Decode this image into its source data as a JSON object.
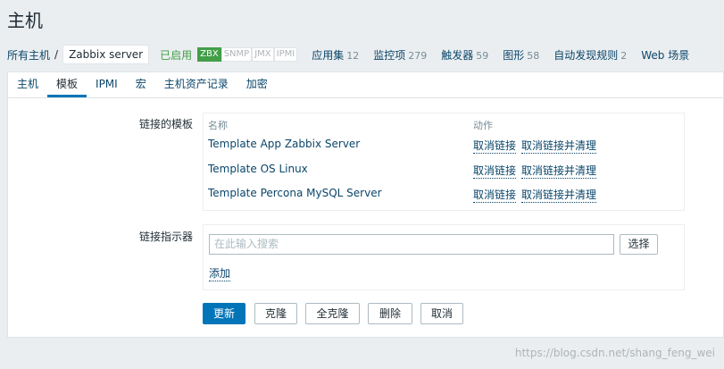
{
  "page": {
    "title": "主机"
  },
  "nav": {
    "all_hosts": "所有主机",
    "separator": "/",
    "current_host": "Zabbix server",
    "status": "已启用",
    "availability": [
      {
        "label": "ZBX",
        "active": true
      },
      {
        "label": "SNMP",
        "active": false
      },
      {
        "label": "JMX",
        "active": false
      },
      {
        "label": "IPMI",
        "active": false
      }
    ],
    "links": [
      {
        "label": "应用集",
        "count": "12"
      },
      {
        "label": "监控项",
        "count": "279"
      },
      {
        "label": "触发器",
        "count": "59"
      },
      {
        "label": "图形",
        "count": "58"
      },
      {
        "label": "自动发现规则",
        "count": "2"
      },
      {
        "label": "Web 场景",
        "count": ""
      }
    ]
  },
  "tabs": [
    {
      "label": "主机",
      "active": false
    },
    {
      "label": "模板",
      "active": true
    },
    {
      "label": "IPMI",
      "active": false
    },
    {
      "label": "宏",
      "active": false
    },
    {
      "label": "主机资产记录",
      "active": false
    },
    {
      "label": "加密",
      "active": false
    }
  ],
  "linked_templates": {
    "label": "链接的模板",
    "col_name": "名称",
    "col_action": "动作",
    "rows": [
      {
        "name": "Template App Zabbix Server",
        "unlink": "取消链接",
        "unlink_clear": "取消链接并清理"
      },
      {
        "name": "Template OS Linux",
        "unlink": "取消链接",
        "unlink_clear": "取消链接并清理"
      },
      {
        "name": "Template Percona MySQL Server",
        "unlink": "取消链接",
        "unlink_clear": "取消链接并清理"
      }
    ]
  },
  "link_new": {
    "label": "链接指示器",
    "search_placeholder": "在此输入搜索",
    "select_button": "选择",
    "add_link": "添加"
  },
  "actions": {
    "update": "更新",
    "clone": "克隆",
    "full_clone": "全克隆",
    "delete": "删除",
    "cancel": "取消"
  },
  "watermark": "https://blog.csdn.net/shang_feng_wei",
  "colors": {
    "accent": "#0275b8",
    "enabled": "#429e47",
    "link": "#0a466a"
  }
}
